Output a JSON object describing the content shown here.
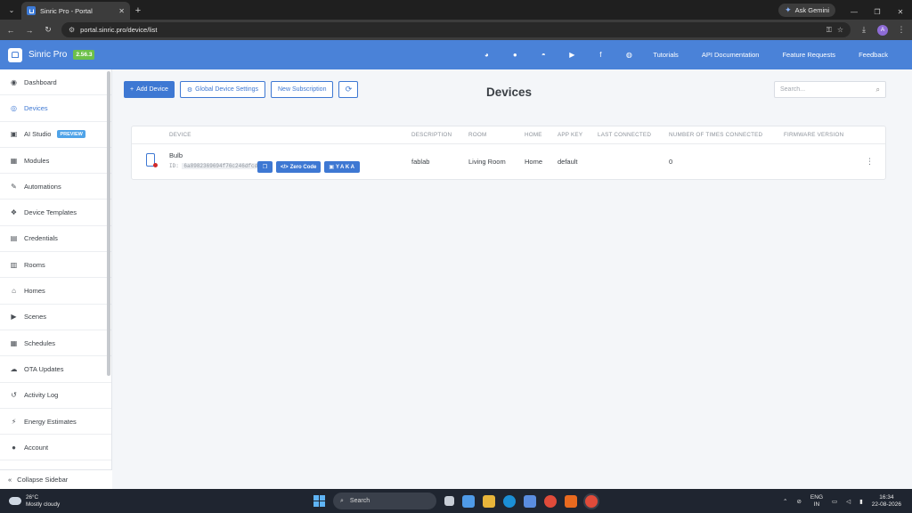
{
  "browser": {
    "tab_title": "Sinric Pro - Portal",
    "url": "portal.sinric.pro/device/list",
    "ask_gemini": "Ask Gemini",
    "avatar_letter": "A"
  },
  "header": {
    "brand": "Sinric Pro",
    "version": "2.56.3",
    "social_icons": [
      "discord-icon",
      "apple-icon",
      "android-icon",
      "youtube-icon",
      "facebook-icon",
      "github-icon"
    ],
    "links": [
      "Tutorials",
      "API Documentation",
      "Feature Requests",
      "Feedback"
    ]
  },
  "sidebar": {
    "items": [
      {
        "label": "Dashboard",
        "icon": "dashboard-icon",
        "glyph": "◉"
      },
      {
        "label": "Devices",
        "icon": "devices-icon",
        "glyph": "◎"
      },
      {
        "label": "AI Studio",
        "icon": "ai-studio-icon",
        "glyph": "▣",
        "badge": "PREVIEW"
      },
      {
        "label": "Modules",
        "icon": "modules-icon",
        "glyph": "▦"
      },
      {
        "label": "Automations",
        "icon": "automations-icon",
        "glyph": "✎"
      },
      {
        "label": "Device Templates",
        "icon": "device-templates-icon",
        "glyph": "❖"
      },
      {
        "label": "Credentials",
        "icon": "credentials-icon",
        "glyph": "▤"
      },
      {
        "label": "Rooms",
        "icon": "rooms-icon",
        "glyph": "▥"
      },
      {
        "label": "Homes",
        "icon": "homes-icon",
        "glyph": "⌂"
      },
      {
        "label": "Scenes",
        "icon": "scenes-icon",
        "glyph": "▶"
      },
      {
        "label": "Schedules",
        "icon": "schedules-icon",
        "glyph": "▦"
      },
      {
        "label": "OTA Updates",
        "icon": "ota-updates-icon",
        "glyph": "☁"
      },
      {
        "label": "Activity Log",
        "icon": "activity-log-icon",
        "glyph": "↺"
      },
      {
        "label": "Energy Estimates",
        "icon": "energy-estimates-icon",
        "glyph": "⚡"
      },
      {
        "label": "Account",
        "icon": "account-icon",
        "glyph": "●"
      }
    ],
    "active": "Devices",
    "collapse_label": "Collapse Sidebar"
  },
  "toolbar": {
    "add_device": "Add Device",
    "global_settings": "Global Device Settings",
    "new_subscription": "New Subscription"
  },
  "page_title": "Devices",
  "search_placeholder": "Search...",
  "table": {
    "columns": [
      "DEVICE",
      "DESCRIPTION",
      "ROOM",
      "HOME",
      "APP KEY",
      "LAST CONNECTED",
      "NUMBER OF TIMES CONNECTED",
      "FIRMWARE VERSION"
    ],
    "rows": [
      {
        "name": "Bulb",
        "id_label": "ID:",
        "id": "6a8982369694f76c246dfcdf",
        "zero_code": "Zero Code",
        "yaka": "YAKA",
        "description": "fablab",
        "room": "Living Room",
        "home": "Home",
        "app_key": "default",
        "last_connected": "",
        "times_connected": "0",
        "firmware": ""
      }
    ]
  },
  "taskbar": {
    "temp": "26°C",
    "condition": "Mostly cloudy",
    "search": "Search",
    "lang_top": "ENG",
    "lang_bottom": "IN",
    "time": "16:34",
    "date": "22-08-2026"
  },
  "colors": {
    "header": "#4a82d8",
    "accent": "#3e78d3",
    "version_badge": "#6cc04a",
    "offline_dot": "#d12b2b"
  }
}
